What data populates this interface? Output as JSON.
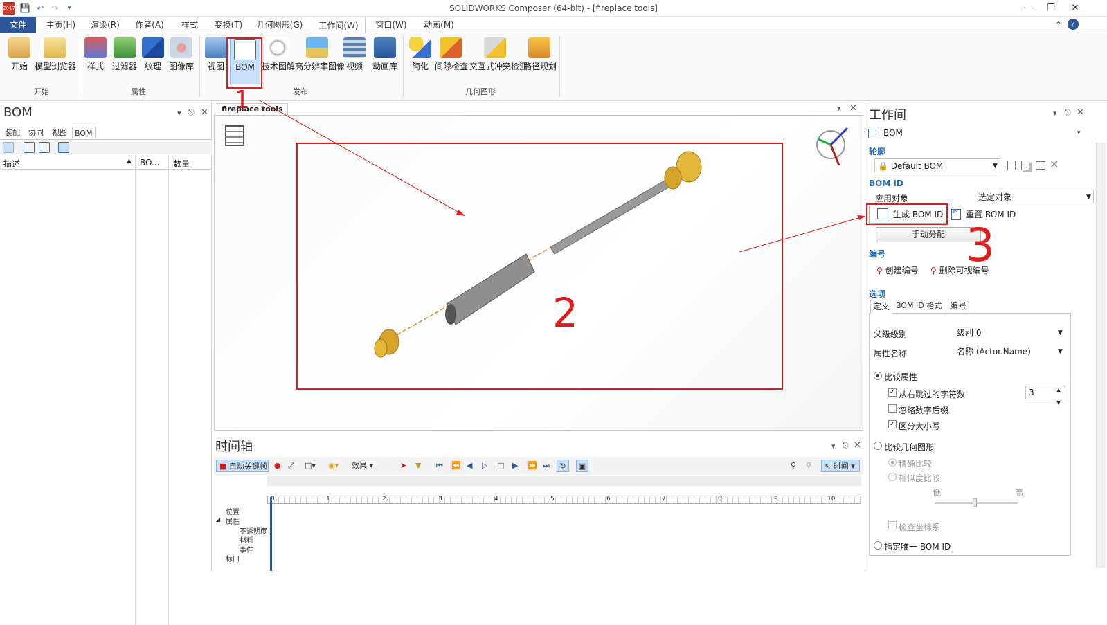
{
  "window": {
    "title": "SOLIDWORKS Composer (64-bit) - [fireplace tools]",
    "year_badge": "2017"
  },
  "menu": [
    "文件",
    "主页(H)",
    "渲染(R)",
    "作者(A)",
    "样式",
    "变换(T)",
    "几何图形(G)",
    "工作间(W)",
    "窗口(W)",
    "动画(M)"
  ],
  "ribbon": {
    "groups": [
      {
        "name": "开始",
        "buttons": [
          "开始",
          "模型浏览器"
        ]
      },
      {
        "name": "属性",
        "buttons": [
          "样式",
          "过滤器",
          "纹理",
          "图像库"
        ]
      },
      {
        "name": "发布",
        "buttons": [
          "视图",
          "BOM",
          "技术图解",
          "高分辨率图像",
          "视频",
          "动画库"
        ]
      },
      {
        "name": "几何图形",
        "buttons": [
          "简化",
          "间隙检查",
          "交互式冲突检测",
          "路径规划"
        ]
      }
    ]
  },
  "left_panel": {
    "title": "BOM",
    "tabs": [
      "装配",
      "协同",
      "视图",
      "BOM"
    ],
    "columns": [
      "描述",
      "BO...",
      "数量"
    ]
  },
  "viewport": {
    "tab": "fireplace tools"
  },
  "timeline": {
    "title": "时间轴",
    "auto_key": "自动关键帧",
    "effect": "效果",
    "time_label": "时间",
    "ruler": [
      "0",
      "1",
      "2",
      "3",
      "4",
      "5",
      "6",
      "7",
      "8",
      "9",
      "10"
    ],
    "rows": [
      "位置",
      "属性",
      "不透明度",
      "材料",
      "事件",
      "标口"
    ]
  },
  "right_panel": {
    "title": "工作间",
    "mode": "BOM",
    "profile_section": "轮廓",
    "profile_value": "Default BOM",
    "bomid_section": "BOM ID",
    "apply_to_label": "应用对象",
    "apply_to_value": "选定对象",
    "generate_btn": "生成 BOM ID",
    "reset_btn": "重置 BOM ID",
    "manual_btn": "手动分配",
    "numbering_section": "编号",
    "create_num": "创建编号",
    "delete_num": "删除可视编号",
    "options_section": "选项",
    "opt_tabs": [
      "定义",
      "BOM ID 格式",
      "编号"
    ],
    "parent_level_label": "父级级别",
    "parent_level_value": "级别 0",
    "prop_name_label": "属性名称",
    "prop_name_value": "名称 (Actor.Name)",
    "compare_props": "比较属性",
    "skip_chars": "从右跳过的字符数",
    "skip_value": "3",
    "ignore_suffix": "忽略数字后缀",
    "case_sensitive": "区分大小写",
    "compare_geom": "比较几何图形",
    "exact": "精确比较",
    "similarity": "相似度比较",
    "low": "低",
    "high": "高",
    "check_coords": "检查坐标系",
    "unique_id": "指定唯一 BOM ID"
  },
  "annotations": {
    "n1": "1",
    "n2": "2",
    "n3": "3"
  },
  "colors": {
    "accent": "#2b579a",
    "annotation": "#e01b1b",
    "highlight": "#c7dff7"
  }
}
